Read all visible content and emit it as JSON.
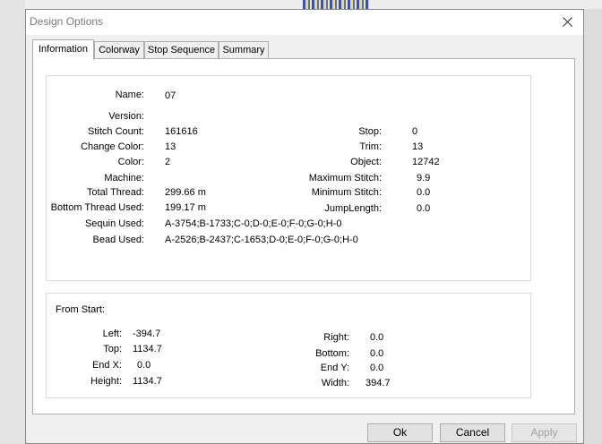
{
  "window": {
    "title": "Design Options"
  },
  "tabs": [
    {
      "label": "Information",
      "active": true
    },
    {
      "label": "Colorway",
      "active": false
    },
    {
      "label": "Stop Sequence",
      "active": false
    },
    {
      "label": "Summary",
      "active": false
    }
  ],
  "info": {
    "name": {
      "label": "Name:",
      "value": "07"
    },
    "version": {
      "label": "Version:",
      "value": ""
    },
    "stitch_count": {
      "label": "Stitch Count:",
      "value": "161616"
    },
    "change_color": {
      "label": "Change Color:",
      "value": "13"
    },
    "color": {
      "label": "Color:",
      "value": "2"
    },
    "machine": {
      "label": "Machine:",
      "value": ""
    },
    "total_thread": {
      "label": "Total Thread:",
      "value": "299.66 m"
    },
    "bottom_thread": {
      "label": "Bottom Thread Used:",
      "value": "199.17 m"
    },
    "sequin_used": {
      "label": "Sequin Used:",
      "value": "A-3754;B-1733;C-0;D-0;E-0;F-0;G-0;H-0"
    },
    "bead_used": {
      "label": "Bead Used:",
      "value": "A-2526;B-2437;C-1653;D-0;E-0;F-0;G-0;H-0"
    },
    "stop": {
      "label": "Stop:",
      "value": "0"
    },
    "trim": {
      "label": "Trim:",
      "value": "13"
    },
    "object": {
      "label": "Object:",
      "value": "12742"
    },
    "max_stitch": {
      "label": "Maximum Stitch:",
      "value": "9.9"
    },
    "min_stitch": {
      "label": "Minimum Stitch:",
      "value": "0.0"
    },
    "jump_length": {
      "label": "JumpLength:",
      "value": "0.0"
    }
  },
  "from_start": {
    "title": "From Start:",
    "left": {
      "label": "Left:",
      "value": "-394.7"
    },
    "top": {
      "label": "Top:",
      "value": "1134.7"
    },
    "end_x": {
      "label": "End X:",
      "value": "0.0"
    },
    "height": {
      "label": "Height:",
      "value": "1134.7"
    },
    "right": {
      "label": "Right:",
      "value": "0.0"
    },
    "bottom": {
      "label": "Bottom:",
      "value": "0.0"
    },
    "end_y": {
      "label": "End Y:",
      "value": "0.0"
    },
    "width": {
      "label": "Width:",
      "value": "394.7"
    }
  },
  "buttons": {
    "ok": "Ok",
    "cancel": "Cancel",
    "apply": "Apply"
  },
  "icons": {
    "close": "close-icon"
  }
}
